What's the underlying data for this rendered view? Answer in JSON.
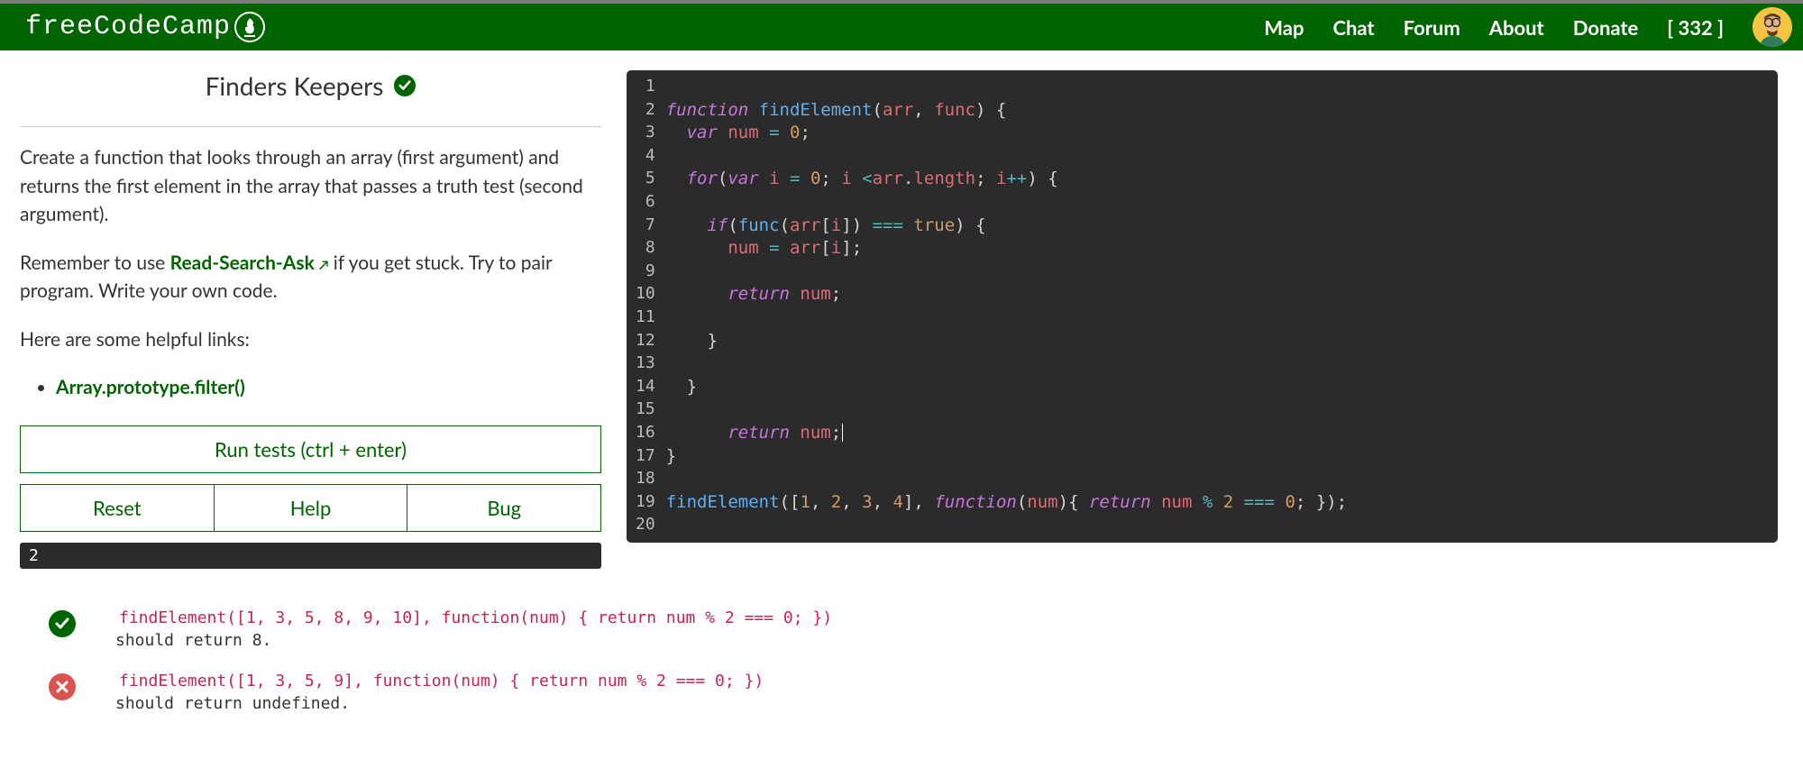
{
  "header": {
    "brand": "freeCodeCamp",
    "nav": [
      "Map",
      "Chat",
      "Forum",
      "About",
      "Donate"
    ],
    "brownie_points": "[ 332 ]"
  },
  "challenge": {
    "title": "Finders Keepers",
    "completed": true,
    "description_p1": "Create a function that looks through an array (first argument) and returns the first element in the array that passes a truth test (second argument).",
    "description_p2_pre": "Remember to use ",
    "description_p2_link": "Read-Search-Ask",
    "description_p2_post": " if you get stuck. Try to pair program. Write your own code.",
    "helpful_label": "Here are some helpful links:",
    "helpful_links": [
      "Array.prototype.filter()"
    ]
  },
  "buttons": {
    "run": "Run tests (ctrl + enter)",
    "reset": "Reset",
    "help": "Help",
    "bug": "Bug"
  },
  "console_output": "2",
  "tests": [
    {
      "status": "pass",
      "code": "findElement([1, 3, 5, 8, 9, 10], function(num) { return num % 2 === 0; })",
      "expect": " should return 8."
    },
    {
      "status": "fail",
      "code": "findElement([1, 3, 5, 9], function(num) { return num % 2 === 0; })",
      "expect": " should return undefined."
    }
  ],
  "editor": {
    "line_count": 20,
    "code_lines": [
      "",
      "function findElement(arr, func) {",
      "  var num = 0;",
      "",
      "  for(var i = 0; i <arr.length; i++) {",
      "",
      "    if(func(arr[i]) === true) {",
      "      num = arr[i];",
      "",
      "      return num;",
      "",
      "    }",
      "",
      "  }",
      "",
      "      return num;",
      "}",
      "",
      "findElement([1, 2, 3, 4], function(num){ return num % 2 === 0; });",
      ""
    ]
  }
}
